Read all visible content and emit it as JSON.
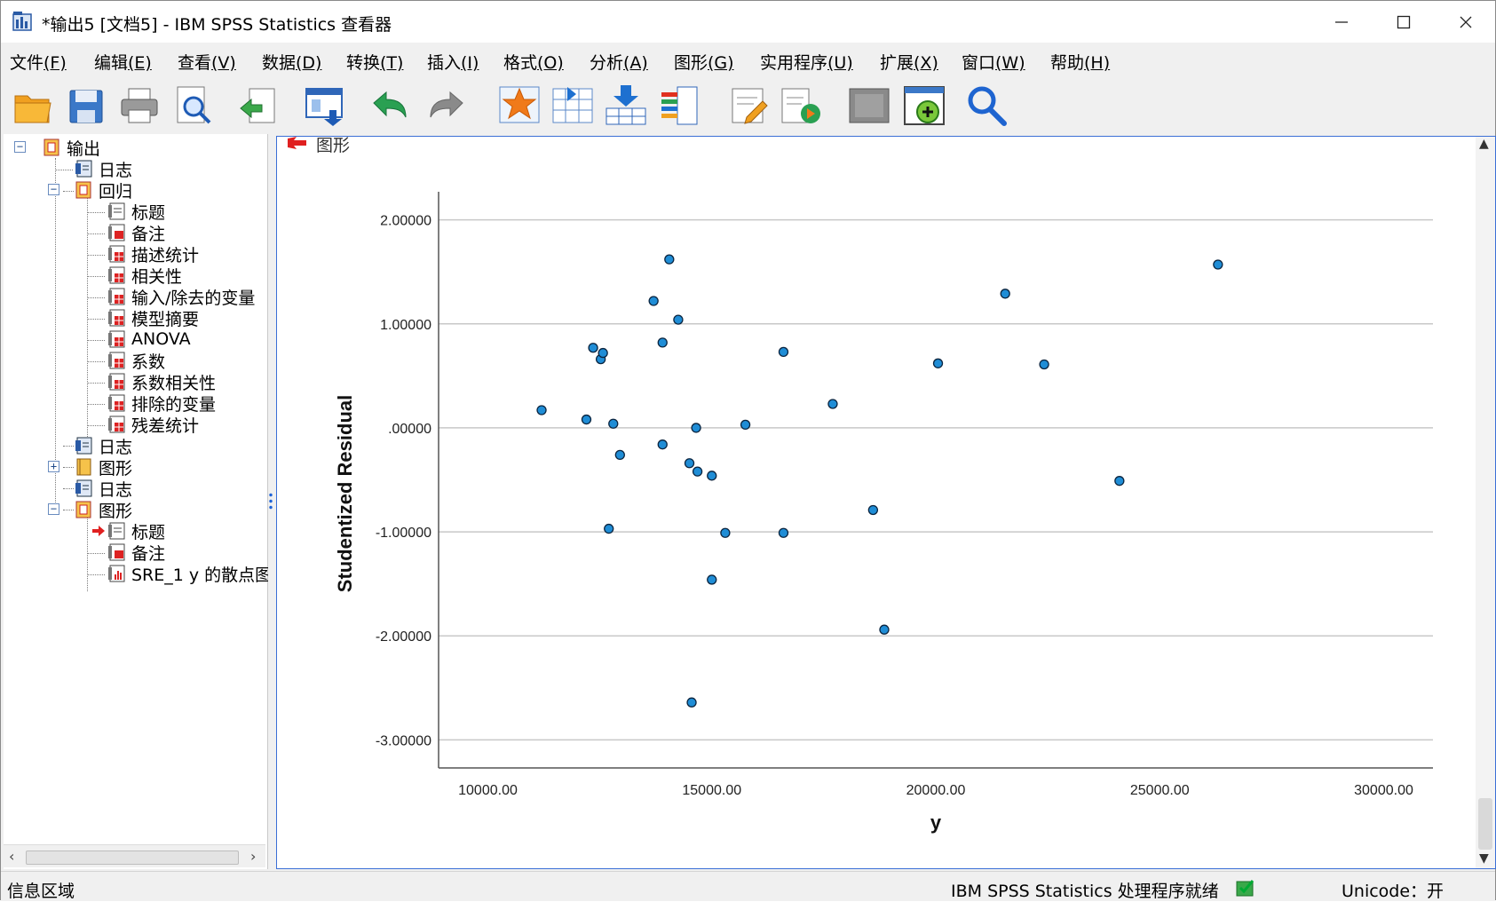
{
  "window": {
    "title": "*输出5 [文档5] - IBM SPSS Statistics 查看器",
    "minimize_label": "—",
    "maximize_label": "☐",
    "close_label": "✕"
  },
  "menu": [
    {
      "label": "文件",
      "key": "(F)"
    },
    {
      "label": "编辑",
      "key": "(E)"
    },
    {
      "label": "查看",
      "key": "(V)"
    },
    {
      "label": "数据",
      "key": "(D)"
    },
    {
      "label": "转换",
      "key": "(T)"
    },
    {
      "label": "插入",
      "key": "(I)"
    },
    {
      "label": "格式",
      "key": "(O)"
    },
    {
      "label": "分析",
      "key": "(A)"
    },
    {
      "label": "图形",
      "key": "(G)"
    },
    {
      "label": "实用程序",
      "key": "(U)"
    },
    {
      "label": "扩展",
      "key": "(X)"
    },
    {
      "label": "窗口",
      "key": "(W)"
    },
    {
      "label": "帮助",
      "key": "(H)"
    }
  ],
  "toolbar_icons": [
    "open-folder-icon",
    "save-icon",
    "print-icon",
    "print-preview-icon",
    "export-icon",
    "recall-dialog-icon",
    "undo-icon",
    "redo-icon",
    "goto-case-icon",
    "goto-variable-icon",
    "select-cases-icon",
    "variables-icon",
    "designate-window-icon",
    "insert-output-icon",
    "show-hide-icon",
    "insert-chart-icon",
    "search-icon"
  ],
  "tree": [
    {
      "label": "输出",
      "level": 0,
      "icon": "output-book-icon",
      "expander": "⊟"
    },
    {
      "label": "日志",
      "level": 1,
      "icon": "log-icon"
    },
    {
      "label": "回归",
      "level": 1,
      "icon": "output-book-icon",
      "expander": "⊟"
    },
    {
      "label": "标题",
      "level": 2,
      "icon": "title-icon"
    },
    {
      "label": "备注",
      "level": 2,
      "icon": "notes-icon"
    },
    {
      "label": "描述统计",
      "level": 2,
      "icon": "table-icon"
    },
    {
      "label": "相关性",
      "level": 2,
      "icon": "table-icon"
    },
    {
      "label": "输入/除去的变量",
      "level": 2,
      "icon": "table-icon"
    },
    {
      "label": "模型摘要",
      "level": 2,
      "icon": "table-icon"
    },
    {
      "label": "ANOVA",
      "level": 2,
      "icon": "table-icon"
    },
    {
      "label": "系数",
      "level": 2,
      "icon": "table-icon"
    },
    {
      "label": "系数相关性",
      "level": 2,
      "icon": "table-icon"
    },
    {
      "label": "排除的变量",
      "level": 2,
      "icon": "table-icon"
    },
    {
      "label": "残差统计",
      "level": 2,
      "icon": "table-icon"
    },
    {
      "label": "日志",
      "level": 1,
      "icon": "log-icon"
    },
    {
      "label": "图形",
      "level": 1,
      "icon": "closed-book-icon",
      "expander": "⊞"
    },
    {
      "label": "日志",
      "level": 1,
      "icon": "log-icon"
    },
    {
      "label": "图形",
      "level": 1,
      "icon": "output-book-icon",
      "expander": "⊟"
    },
    {
      "label": "标题",
      "level": 2,
      "icon": "title-icon",
      "current": true
    },
    {
      "label": "备注",
      "level": 2,
      "icon": "notes-icon"
    },
    {
      "label": "SRE_1 y 的散点图",
      "level": 2,
      "icon": "chart-icon"
    }
  ],
  "content": {
    "section_label": "图形"
  },
  "chart_data": {
    "type": "scatter",
    "title": "",
    "xlabel": "y",
    "ylabel": "Studentized Residual",
    "xlim": [
      8900,
      31100
    ],
    "ylim": [
      -3.27,
      2.27
    ],
    "x_ticks": [
      10000,
      15000,
      20000,
      25000,
      30000
    ],
    "x_tick_labels": [
      "10000.00",
      "15000.00",
      "20000.00",
      "25000.00",
      "30000.00"
    ],
    "y_ticks": [
      2,
      1,
      0,
      -1,
      -2,
      -3
    ],
    "y_tick_labels": [
      "2.00000",
      "1.00000",
      ".00000",
      "-1.00000",
      "-2.00000",
      "-3.00000"
    ],
    "grid": "horizontal",
    "marker_color": "#1f8dd6",
    "points": [
      {
        "x": 11200,
        "y": 0.17
      },
      {
        "x": 12200,
        "y": 0.08
      },
      {
        "x": 12350,
        "y": 0.77
      },
      {
        "x": 12520,
        "y": 0.66
      },
      {
        "x": 12570,
        "y": 0.72
      },
      {
        "x": 12700,
        "y": -0.97
      },
      {
        "x": 12800,
        "y": 0.04
      },
      {
        "x": 12950,
        "y": -0.26
      },
      {
        "x": 13700,
        "y": 1.22
      },
      {
        "x": 13900,
        "y": 0.82
      },
      {
        "x": 13900,
        "y": -0.16
      },
      {
        "x": 14050,
        "y": 1.62
      },
      {
        "x": 14250,
        "y": 1.04
      },
      {
        "x": 14500,
        "y": -0.34
      },
      {
        "x": 14550,
        "y": -2.64
      },
      {
        "x": 14650,
        "y": 0.0
      },
      {
        "x": 14680,
        "y": -0.42
      },
      {
        "x": 15000,
        "y": -0.46
      },
      {
        "x": 15000,
        "y": -1.46
      },
      {
        "x": 15300,
        "y": -1.01
      },
      {
        "x": 15750,
        "y": 0.03
      },
      {
        "x": 16600,
        "y": 0.73
      },
      {
        "x": 16600,
        "y": -1.01
      },
      {
        "x": 17700,
        "y": 0.23
      },
      {
        "x": 18600,
        "y": -0.79
      },
      {
        "x": 18850,
        "y": -1.94
      },
      {
        "x": 20050,
        "y": 0.62
      },
      {
        "x": 21550,
        "y": 1.29
      },
      {
        "x": 22420,
        "y": 0.61
      },
      {
        "x": 24100,
        "y": -0.51
      },
      {
        "x": 26300,
        "y": 1.57
      }
    ]
  },
  "status": {
    "left": "信息区域",
    "processor": "IBM SPSS Statistics 处理程序就绪",
    "unicode": "Unicode：开"
  }
}
